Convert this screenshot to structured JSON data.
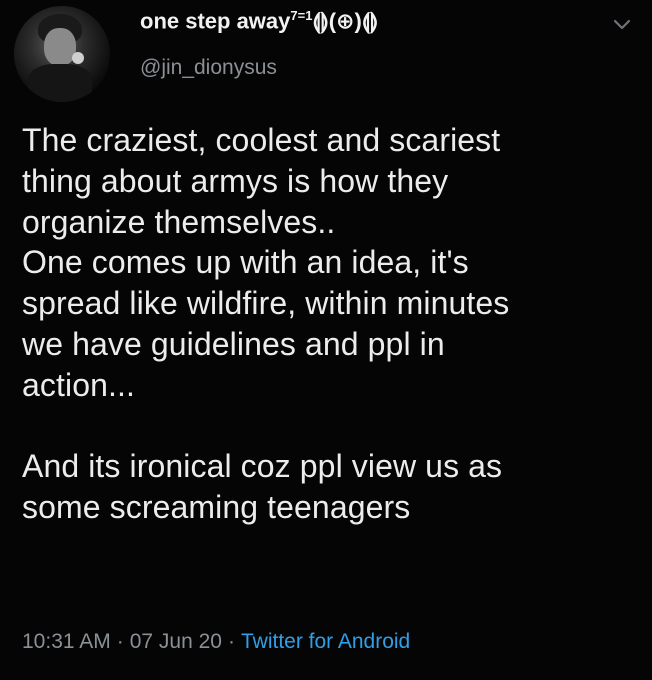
{
  "tweet": {
    "display_name": "one step away",
    "display_name_sup": "7=1",
    "display_name_symbols": "⟬⟭(⊕)⟬⟭",
    "handle": "@jin_dionysus",
    "text": "The craziest, coolest and scariest\nthing about armys is how they\norganize themselves..\nOne comes up with an idea, it's\nspread like wildfire, within minutes\nwe have guidelines and ppl in\naction...\n\nAnd its ironical coz ppl view us as\nsome screaming teenagers",
    "time": "10:31 AM",
    "separator": "·",
    "date": "07 Jun 20",
    "source": "Twitter for Android"
  },
  "icons": {
    "menu": "chevron-down-icon",
    "avatar": "avatar-image"
  },
  "colors": {
    "background": "#050505",
    "text": "#ececec",
    "secondary": "#8b9096",
    "link": "#2f9fe9"
  }
}
